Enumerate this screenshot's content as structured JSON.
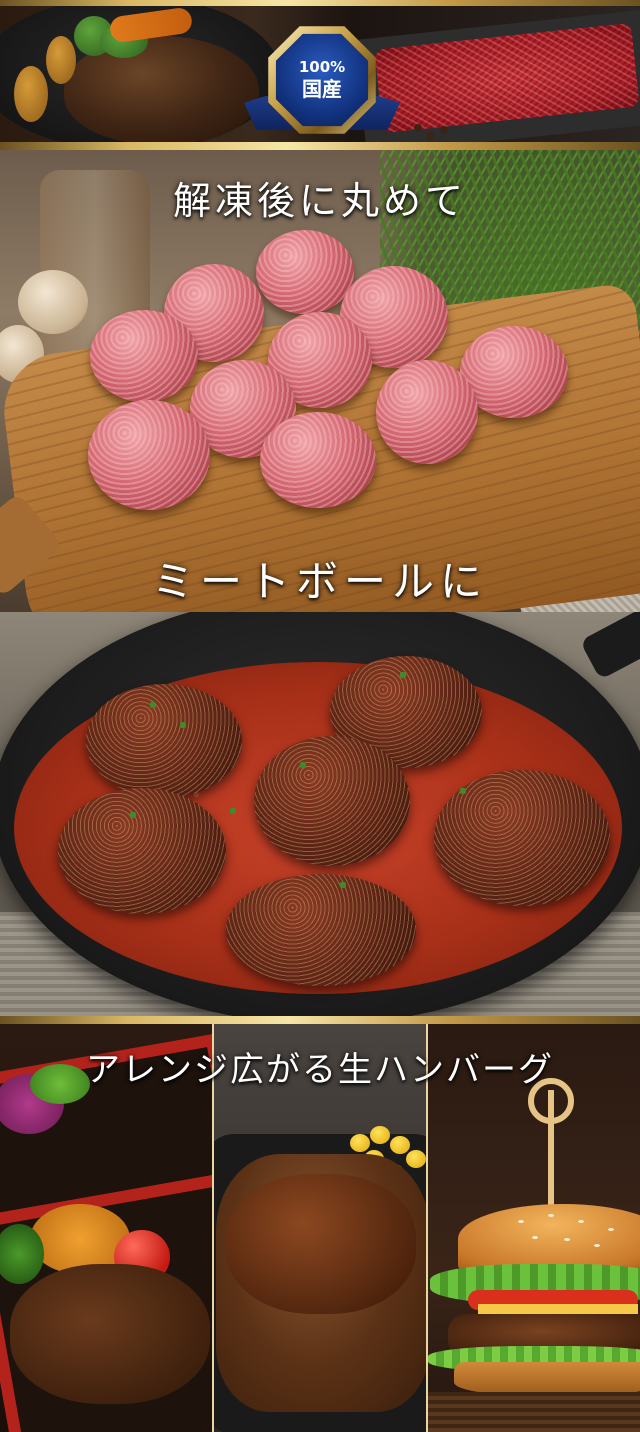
{
  "badge": {
    "percent": "100%",
    "label": "国産"
  },
  "sections": {
    "meatball_prep": {
      "caption": "解凍後に丸めて"
    },
    "meatball_dish": {
      "caption": "ミートボールに"
    },
    "arrange": {
      "caption": "アレンジ広がる生ハンバーグ"
    }
  },
  "panels": [
    "bento-panel",
    "hamburg-steak-panel",
    "burger-panel"
  ]
}
